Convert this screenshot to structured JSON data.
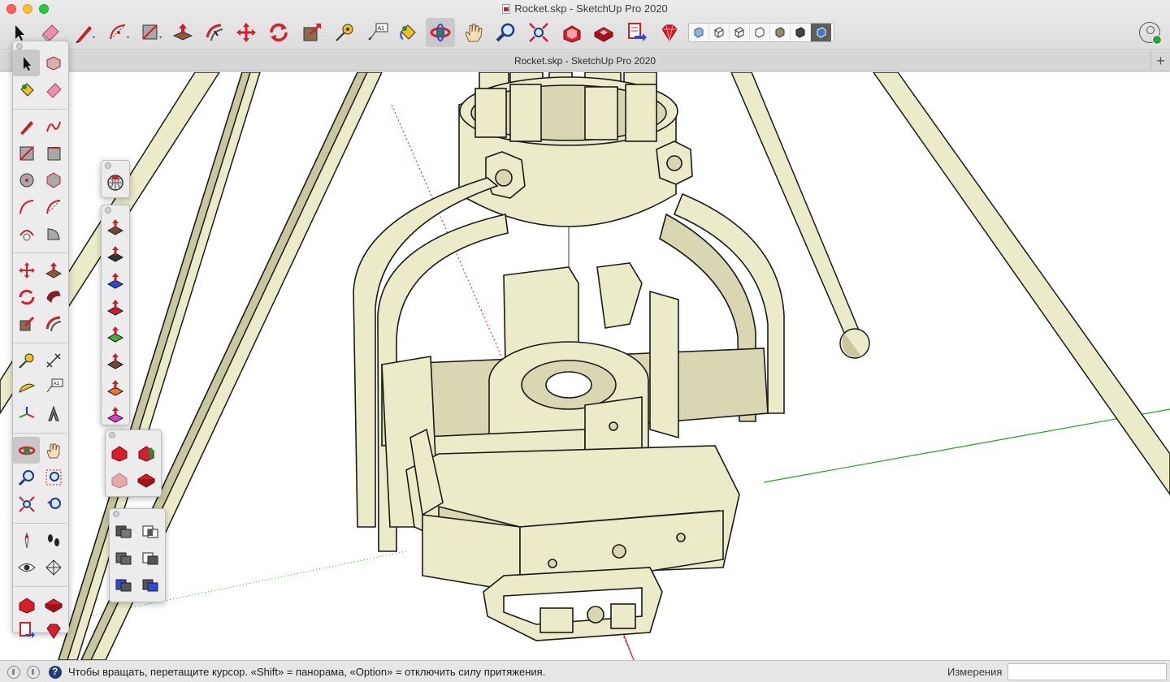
{
  "window": {
    "title": "Rocket.skp - SketchUp Pro 2020",
    "document_tab": "Rocket.skp - SketchUp Pro 2020",
    "new_tab_symbol": "+"
  },
  "toolbar": {
    "tools": [
      {
        "name": "select-tool",
        "icon": "arrow-cursor-icon"
      },
      {
        "name": "eraser-tool",
        "icon": "eraser-icon"
      },
      {
        "name": "line-tool",
        "icon": "pencil-icon"
      },
      {
        "name": "arc-tool",
        "icon": "arc-icon"
      },
      {
        "name": "rectangle-tool",
        "icon": "rectangle-icon"
      },
      {
        "name": "push-pull-tool",
        "icon": "push-pull-icon"
      },
      {
        "name": "offset-tool",
        "icon": "offset-icon"
      },
      {
        "name": "move-tool",
        "icon": "move-icon"
      },
      {
        "name": "rotate-tool",
        "icon": "rotate-icon"
      },
      {
        "name": "scale-tool",
        "icon": "scale-icon"
      },
      {
        "name": "tape-measure-tool",
        "icon": "tape-measure-icon"
      },
      {
        "name": "text-tool",
        "icon": "text-label-icon"
      },
      {
        "name": "paint-bucket-tool",
        "icon": "paint-bucket-icon"
      },
      {
        "name": "orbit-tool",
        "icon": "orbit-icon",
        "active": true
      },
      {
        "name": "pan-tool",
        "icon": "hand-icon"
      },
      {
        "name": "zoom-tool",
        "icon": "magnifier-icon"
      },
      {
        "name": "zoom-extents-tool",
        "icon": "zoom-extents-icon"
      },
      {
        "name": "3d-warehouse-tool",
        "icon": "warehouse-icon"
      },
      {
        "name": "extension-warehouse-tool",
        "icon": "extension-warehouse-icon"
      },
      {
        "name": "share-model-tool",
        "icon": "share-model-icon"
      },
      {
        "name": "extension-manager-tool",
        "icon": "ruby-gem-icon"
      }
    ],
    "styles": [
      "xray-style-icon",
      "back-edges-style-icon",
      "wireframe-style-icon",
      "hidden-line-style-icon",
      "shaded-style-icon",
      "shaded-textures-style-icon",
      "monochrome-style-icon"
    ]
  },
  "status": {
    "hint": "Чтобы вращать, перетащите курсор. «Shift» = панорама, «Option» = отключить силу притяжения.",
    "measurements_label": "Измерения",
    "measurements_value": ""
  },
  "colors": {
    "model_fill": "#ecebc9",
    "model_shadow": "#c9c7a0",
    "model_edge": "#1a1a1a",
    "axis_red": "#d42020",
    "axis_green": "#1fa31f",
    "axis_blue": "#2a2ad8",
    "accent_red": "#c8202a"
  }
}
